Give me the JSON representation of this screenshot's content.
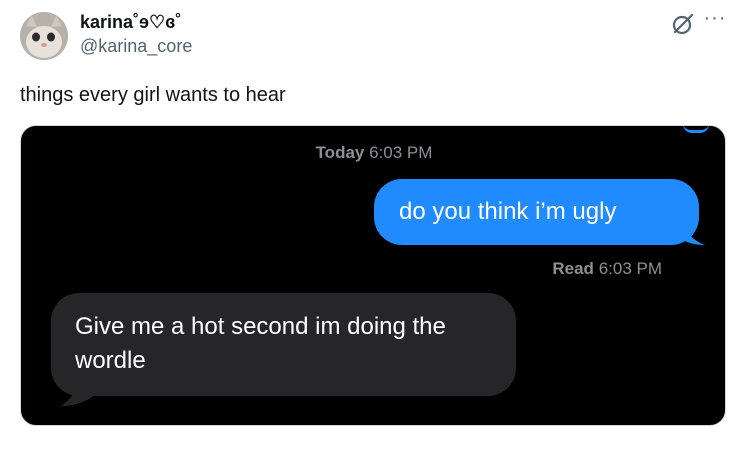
{
  "tweet": {
    "display_name": "karina˚ɘ♡ɞ˚",
    "handle": "@karina_core",
    "text": "things every girl wants to hear"
  },
  "icons": {
    "grok": "grok-icon",
    "more": "more-options-icon",
    "avatar": "avatar"
  },
  "conversation": {
    "timestamp_label": "Today",
    "timestamp_time": "6:03 PM",
    "sent_message": "do you think i’m ugly",
    "read_label": "Read",
    "read_time": "6:03 PM",
    "received_message": "Give me a hot second im doing the wordle"
  },
  "colors": {
    "sent_bubble": "#1f8bff",
    "received_bubble": "#262629",
    "screen_background": "#000000",
    "timestamp_text": "#8e8e93"
  }
}
